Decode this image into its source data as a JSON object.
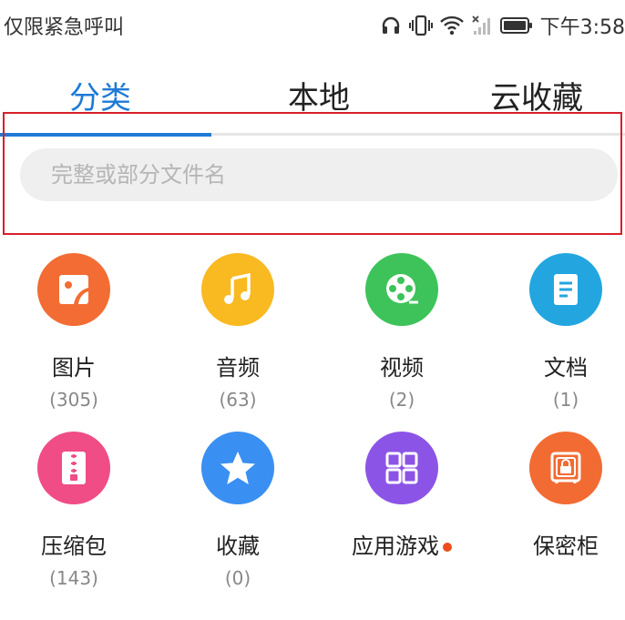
{
  "status_bar": {
    "carrier_text": "仅限紧急呼叫",
    "time": "下午3:58",
    "icons": [
      "headphones-icon",
      "vibrate-icon",
      "wifi-icon",
      "no-signal-icon",
      "battery-icon"
    ]
  },
  "tabs": [
    {
      "label": "分类",
      "active": true
    },
    {
      "label": "本地",
      "active": false
    },
    {
      "label": "云收藏",
      "active": false
    }
  ],
  "search": {
    "placeholder": "完整或部分文件名",
    "value": ""
  },
  "categories": [
    {
      "label": "图片",
      "count": "(305)",
      "icon": "image-icon",
      "color": "#f26c33"
    },
    {
      "label": "音频",
      "count": "(63)",
      "icon": "music-icon",
      "color": "#f9b921"
    },
    {
      "label": "视频",
      "count": "(2)",
      "icon": "film-reel-icon",
      "color": "#3dc35a"
    },
    {
      "label": "文档",
      "count": "(1)",
      "icon": "document-icon",
      "color": "#23a6e0"
    },
    {
      "label": "压缩包",
      "count": "(143)",
      "icon": "zip-icon",
      "color": "#f04c86"
    },
    {
      "label": "收藏",
      "count": "(0)",
      "icon": "star-icon",
      "color": "#3a8ff2"
    },
    {
      "label": "应用游戏",
      "count": "",
      "icon": "apps-grid-icon",
      "color": "#8c54e6",
      "badge_color": "#ee4d1c"
    },
    {
      "label": "保密柜",
      "count": "",
      "icon": "safe-icon",
      "color": "#f26b33"
    }
  ],
  "colors": {
    "accent": "#1e7ad6",
    "highlight_border": "#d6202a"
  }
}
